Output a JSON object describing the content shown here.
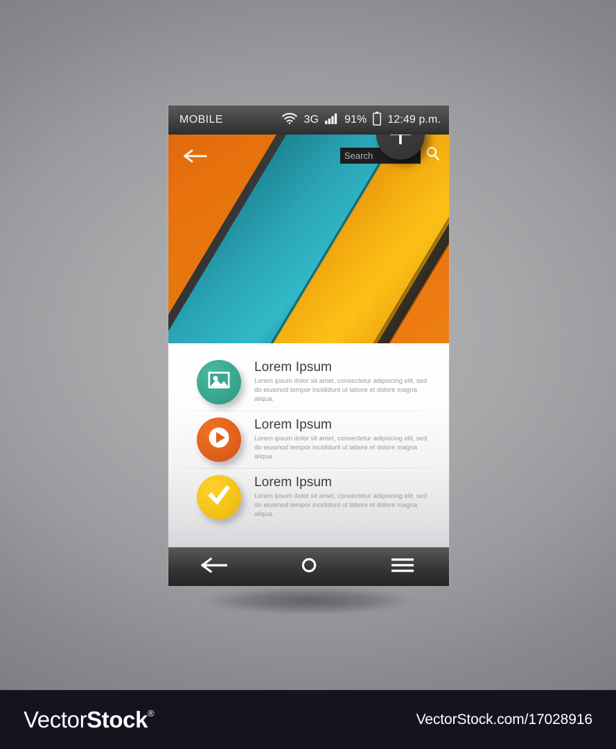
{
  "statusbar": {
    "carrier": "MOBILE",
    "wifi_icon": "wifi-icon",
    "network": "3G",
    "signal_icon": "signal-bars-icon",
    "battery_percent": "91%",
    "battery_icon": "battery-icon",
    "time": "12:49 p.m."
  },
  "hero": {
    "back_icon": "back-arrow-icon",
    "search_placeholder": "Search",
    "search_value": "",
    "search_icon": "search-magnifier-icon",
    "fab_icon": "plus-icon",
    "colors": {
      "orange": "#e8720d",
      "teal": "#2aa4b6",
      "yellow": "#fcc117",
      "dark": "#343434",
      "teal_green": "#2bab9d"
    }
  },
  "list": {
    "items": [
      {
        "icon": "image-photo-icon",
        "icon_color": "#3aa890",
        "title": "Lorem Ipsum",
        "description": "Lorem ipsum dolor sit amet, consectetur adipiscing elit, sed do eiusmod tempor incididunt ut labore et dolore magna aliqua."
      },
      {
        "icon": "play-button-icon",
        "icon_color": "#e2611c",
        "title": "Lorem Ipsum",
        "description": "Lorem ipsum dolor sit amet, consectetur adipiscing elit, sed do eiusmod tempor incididunt ut labore et dolore magna aliqua."
      },
      {
        "icon": "checkmark-icon",
        "icon_color": "#f5c419",
        "title": "Lorem Ipsum",
        "description": "Lorem ipsum dolor sit amet, consectetur adipiscing elit, sed do eiusmod tempor incididunt ut labore et dolore magna aliqua."
      }
    ]
  },
  "navbar": {
    "back_icon": "back-arrow-icon",
    "home_icon": "home-circle-icon",
    "menu_icon": "hamburger-menu-icon"
  },
  "footer": {
    "logo_part1": "Vector",
    "logo_part2": "Stock",
    "logo_registered": "®",
    "url": "VectorStock.com/17028916"
  }
}
